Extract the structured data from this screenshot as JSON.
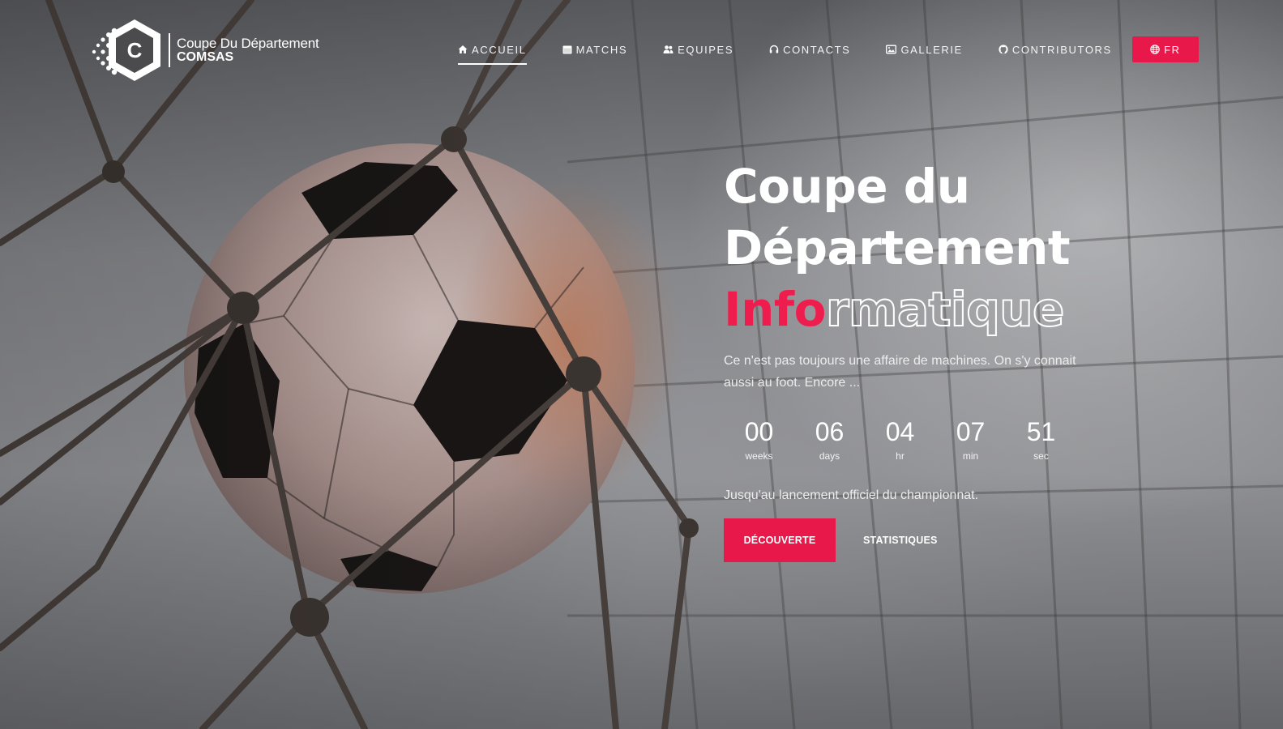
{
  "brand": {
    "logo_letter": "C",
    "line1": "Coupe Du Département",
    "line2": "COMSAS"
  },
  "nav": {
    "items": [
      {
        "label": "ACCUEIL",
        "icon": "home-icon",
        "active": true
      },
      {
        "label": "MATCHS",
        "icon": "calendar-icon",
        "active": false
      },
      {
        "label": "EQUIPES",
        "icon": "users-icon",
        "active": false
      },
      {
        "label": "CONTACTS",
        "icon": "headset-icon",
        "active": false
      },
      {
        "label": "GALLERIE",
        "icon": "image-icon",
        "active": false
      },
      {
        "label": "CONTRIBUTORS",
        "icon": "github-icon",
        "active": false
      }
    ],
    "language": {
      "label": "FR",
      "icon": "globe-icon"
    }
  },
  "hero": {
    "title_line1": "Coupe du",
    "title_line2": "Département",
    "title_line3_accent": "Info",
    "title_line3_outline": "rmatique",
    "subtitle": "Ce n'est pas toujours une affaire de machines. On s'y connait aussi au foot. Encore ...",
    "countdown": [
      {
        "value": "00",
        "unit": "weeks"
      },
      {
        "value": "06",
        "unit": "days"
      },
      {
        "value": "04",
        "unit": "hr"
      },
      {
        "value": "07",
        "unit": "min"
      },
      {
        "value": "51",
        "unit": "sec"
      }
    ],
    "note": "Jusqu'au lancement officiel du championnat.",
    "primary_cta": "DÉCOUVERTE",
    "secondary_cta": "STATISTIQUES"
  },
  "colors": {
    "accent": "#e8194a",
    "text": "#ffffff"
  }
}
